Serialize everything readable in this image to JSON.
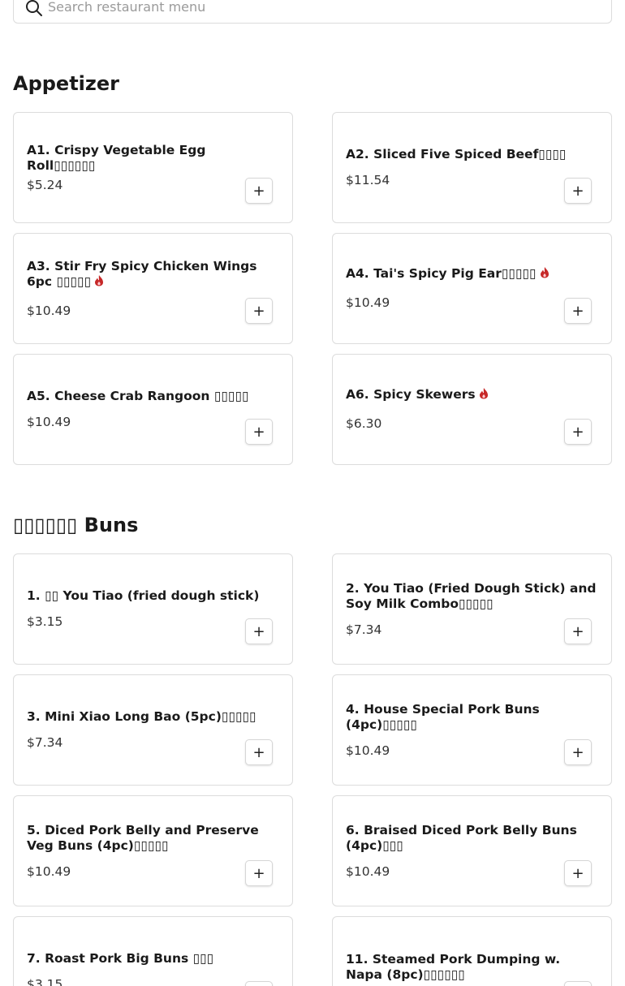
{
  "search": {
    "placeholder": "Search restaurant menu"
  },
  "sections": [
    {
      "title": "Appetizer",
      "items": [
        {
          "name": "A1. Crispy Vegetable Egg Roll▯▯▯▯▯▯",
          "price": "$5.24",
          "spicy": false
        },
        {
          "name": "A2. Sliced Five Spiced Beef▯▯▯▯",
          "price": "$11.54",
          "spicy": false
        },
        {
          "name": "A3. Stir Fry Spicy Chicken Wings 6pc ▯▯▯▯▯",
          "price": "$10.49",
          "spicy": true
        },
        {
          "name": "A4. Tai's Spicy Pig Ear▯▯▯▯▯",
          "price": "$10.49",
          "spicy": true
        },
        {
          "name": "A5. Cheese Crab Rangoon ▯▯▯▯▯",
          "price": "$10.49",
          "spicy": false
        },
        {
          "name": "A6. Spicy Skewers",
          "price": "$6.30",
          "spicy": true
        }
      ]
    },
    {
      "title": "▯▯▯▯▯▯ Buns",
      "items": [
        {
          "name": "1. ▯▯ You Tiao (fried dough stick)",
          "price": "$3.15",
          "spicy": false
        },
        {
          "name": "2. You Tiao (Fried Dough Stick) and Soy Milk Combo▯▯▯▯▯",
          "price": "$7.34",
          "spicy": false
        },
        {
          "name": "3. Mini Xiao Long Bao (5pc)▯▯▯▯▯",
          "price": "$7.34",
          "spicy": false
        },
        {
          "name": "4. House Special Pork Buns (4pc)▯▯▯▯▯",
          "price": "$10.49",
          "spicy": false
        },
        {
          "name": "5. Diced Pork Belly and Preserve Veg Buns (4pc)▯▯▯▯▯",
          "price": "$10.49",
          "spicy": false
        },
        {
          "name": "6. Braised Diced Pork Belly Buns (4pc)▯▯▯",
          "price": "$10.49",
          "spicy": false
        },
        {
          "name": "7. Roast Pork Big Buns ▯▯▯",
          "price": "$3.15",
          "spicy": false
        },
        {
          "name": "11. Steamed Pork Dumping w. Napa (8pc)▯▯▯▯▯▯",
          "price": "",
          "spicy": false
        }
      ]
    }
  ],
  "add_label": "+",
  "colors": {
    "chili": "#c62828",
    "border": "#dcdcdc",
    "text": "#1a1a1a"
  }
}
